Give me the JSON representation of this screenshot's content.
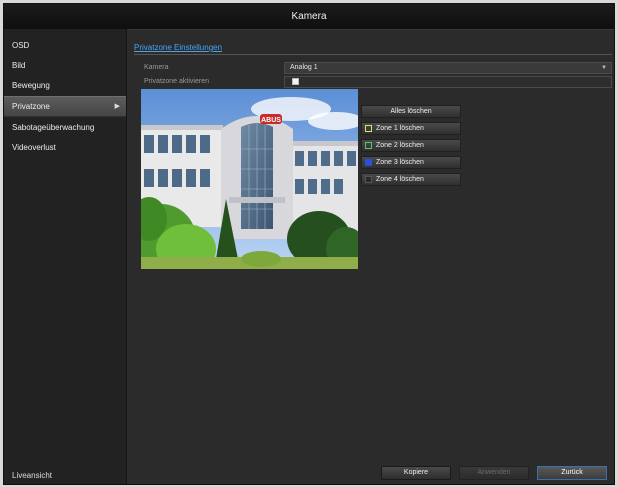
{
  "window": {
    "title": "Kamera"
  },
  "sidebar": {
    "items": [
      {
        "label": "OSD"
      },
      {
        "label": "Bild"
      },
      {
        "label": "Bewegung"
      },
      {
        "label": "Privatzone",
        "active": true
      },
      {
        "label": "Sabotageüberwachung"
      },
      {
        "label": "Videoverlust"
      }
    ],
    "footer": "Liveansicht"
  },
  "main": {
    "section_title": "Privatzone Einstellungen",
    "camera": {
      "label": "Kamera",
      "value": "Analog 1"
    },
    "privacy": {
      "label": "Privatzone aktivieren",
      "checked": true
    },
    "buttons": {
      "clear_all": "Alles löschen",
      "zones": [
        {
          "label": "Zone 1 löschen",
          "color": "#d8e36a"
        },
        {
          "label": "Zone 2 löschen",
          "color": "#55c56a"
        },
        {
          "label": "Zone 3 löschen",
          "color": "#2b4fd6"
        },
        {
          "label": "Zone 4 löschen",
          "color": "#2a2a2a"
        }
      ]
    }
  },
  "footer": {
    "copy": "Kopiere",
    "apply": "Anwenden",
    "back": "Zurück"
  },
  "colors": {
    "accent": "#4aa3f0",
    "background": "#2b2b2b"
  }
}
